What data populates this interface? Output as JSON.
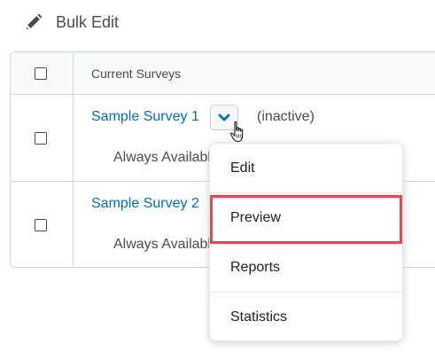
{
  "toolbar": {
    "bulk_edit_label": "Bulk Edit",
    "bulk_edit_icon": "pencil-edit-icon"
  },
  "table": {
    "header": {
      "column_label": "Current Surveys"
    },
    "rows": [
      {
        "name": "Sample Survey 1",
        "status": "(inactive)",
        "availability": "Always Available"
      },
      {
        "name": "Sample Survey 2",
        "status": "",
        "availability": "Always Available"
      }
    ]
  },
  "context_menu": {
    "trigger_icon": "chevron-down-icon",
    "items": [
      {
        "label": "Edit"
      },
      {
        "label": "Preview",
        "highlighted": true
      },
      {
        "label": "Reports"
      },
      {
        "label": "Statistics"
      }
    ]
  },
  "colors": {
    "link": "#006fbf",
    "highlight_border": "#e8464f",
    "text": "#494c4e",
    "border": "#d3d9e3"
  }
}
